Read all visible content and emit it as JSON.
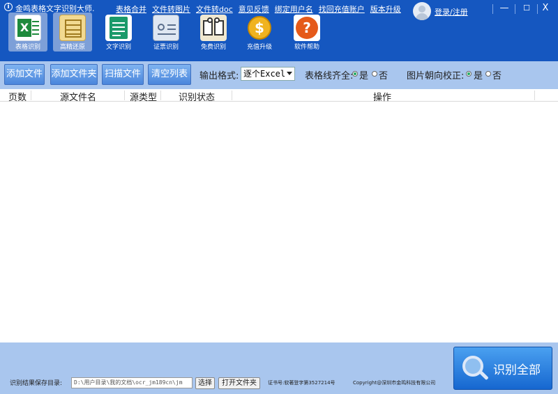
{
  "app": {
    "title": "金鸣表格文字识别大师.",
    "info_icon": "i"
  },
  "top_links": [
    "表格合并",
    "文件转图片",
    "文件转doc",
    "意见反馈",
    "绑定用户名",
    "找回充值账户",
    "版本升级"
  ],
  "account": {
    "login_label": "登录/注册"
  },
  "window": {
    "minimize": "—",
    "maximize": "☐",
    "close": "X"
  },
  "toolbar": [
    {
      "label": "表格识别",
      "icon": "excel-icon",
      "color": "#1e8a3c",
      "active": true
    },
    {
      "label": "高精还原",
      "icon": "document-grid-icon",
      "color": "#e8c25a",
      "active": true
    },
    {
      "label": "文字识别",
      "icon": "text-document-icon",
      "color": "#1b9a6a",
      "active": false
    },
    {
      "label": "证票识别",
      "icon": "id-card-icon",
      "color": "#dfe7f2",
      "active": false
    },
    {
      "label": "免费识别",
      "icon": "book-icon",
      "color": "#f0e8d0",
      "active": false
    },
    {
      "label": "充值升级",
      "icon": "coin-icon",
      "color": "#f0b320",
      "active": false
    },
    {
      "label": "软件帮助",
      "icon": "help-icon",
      "color": "#e55a1a",
      "active": false
    }
  ],
  "actions": {
    "add_file": "添加文件",
    "add_folder": "添加文件夹",
    "scan_file": "扫描文件",
    "clear_list": "清空列表",
    "output_format_label": "输出格式:",
    "output_format_value": "逐个Excel",
    "table_align_label": "表格线齐全:",
    "image_orient_label": "图片朝向校正:",
    "yes": "是",
    "no": "否"
  },
  "table": {
    "columns": [
      "页数",
      "源文件名",
      "源类型",
      "识别状态",
      "操作"
    ],
    "rows": []
  },
  "footer": {
    "save_dir_label": "识别结果保存目录:",
    "save_dir_value": "D:\\用户目录\\我的文档\\ocr_jm189cn\\jm",
    "choose_button": "选择",
    "open_folder_button": "打开文件夹",
    "cert": "证书号:软著登字第3527214号",
    "copyright": "Copyright@深圳市金鸣科技有限公司",
    "recognize_all": "识别全部"
  }
}
